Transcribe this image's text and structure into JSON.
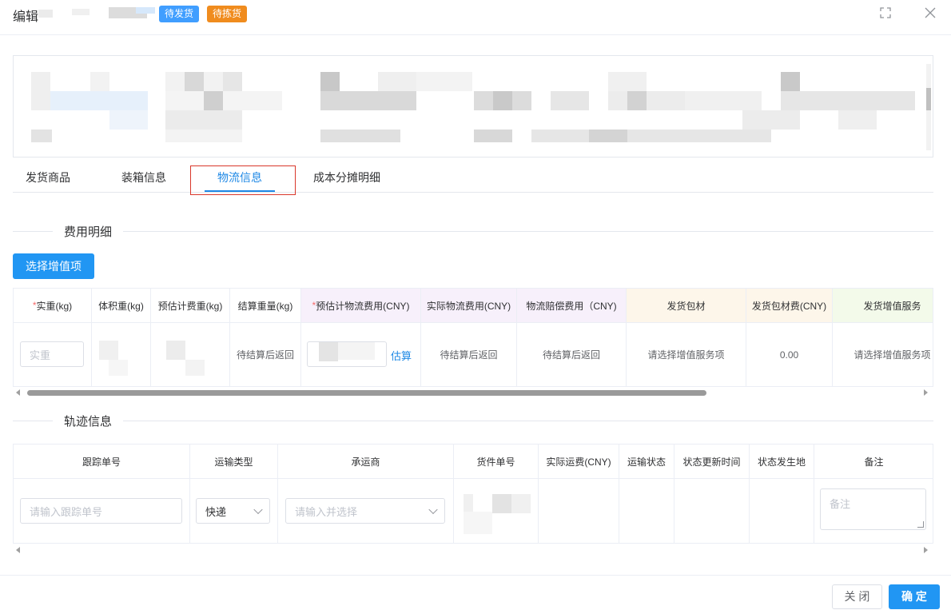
{
  "dialog": {
    "title": "编辑",
    "status_badges": [
      {
        "label": "待发货",
        "color": "#409eff"
      },
      {
        "label": "待拣货",
        "color": "#f08c1e"
      }
    ],
    "maximize_icon": "maximize-icon",
    "close_icon": "close-icon"
  },
  "tabs": [
    {
      "label": "发货商品",
      "active": false
    },
    {
      "label": "装箱信息",
      "active": false
    },
    {
      "label": "物流信息",
      "active": true
    },
    {
      "label": "成本分摊明细",
      "active": false
    }
  ],
  "fee_section": {
    "title": "费用明细",
    "add_value_button": "选择增值项",
    "columns": [
      {
        "label": "实重(kg)",
        "required": true
      },
      {
        "label": "体积重(kg)",
        "required": false
      },
      {
        "label": "预估计费重(kg)",
        "required": false
      },
      {
        "label": "结算重量(kg)",
        "required": false
      },
      {
        "label": "预估计物流费用(CNY)",
        "required": true
      },
      {
        "label": "实际物流费用(CNY)",
        "required": false
      },
      {
        "label": "物流赔偿费用（CNY)",
        "required": false
      },
      {
        "label": "发货包材",
        "required": false
      },
      {
        "label": "发货包材费(CNY)",
        "required": false
      },
      {
        "label": "发货增值服务",
        "required": false
      }
    ],
    "row": {
      "actual_weight_placeholder": "实重",
      "settle_weight": "待结算后返回",
      "estimate_link": "估算",
      "actual_fee": "待结算后返回",
      "compensation_fee": "待结算后返回",
      "packaging": "请选择增值服务项",
      "packaging_fee": "0.00",
      "value_added": "请选择增值服务项"
    },
    "accent_colors": {
      "pink": "#f7f0fb",
      "cream": "#fdf6ea",
      "green": "#f3faea"
    }
  },
  "track_section": {
    "title": "轨迹信息",
    "columns": [
      "跟踪单号",
      "运输类型",
      "承运商",
      "货件单号",
      "实际运费(CNY)",
      "运输状态",
      "状态更新时间",
      "状态发生地",
      "备注"
    ],
    "row": {
      "tracking_placeholder": "请输入跟踪单号",
      "transport_type": "快递",
      "carrier_placeholder": "请输入并选择",
      "remark_placeholder": "备注"
    }
  },
  "footer": {
    "close_label": "关 闭",
    "confirm_label": "确 定"
  }
}
